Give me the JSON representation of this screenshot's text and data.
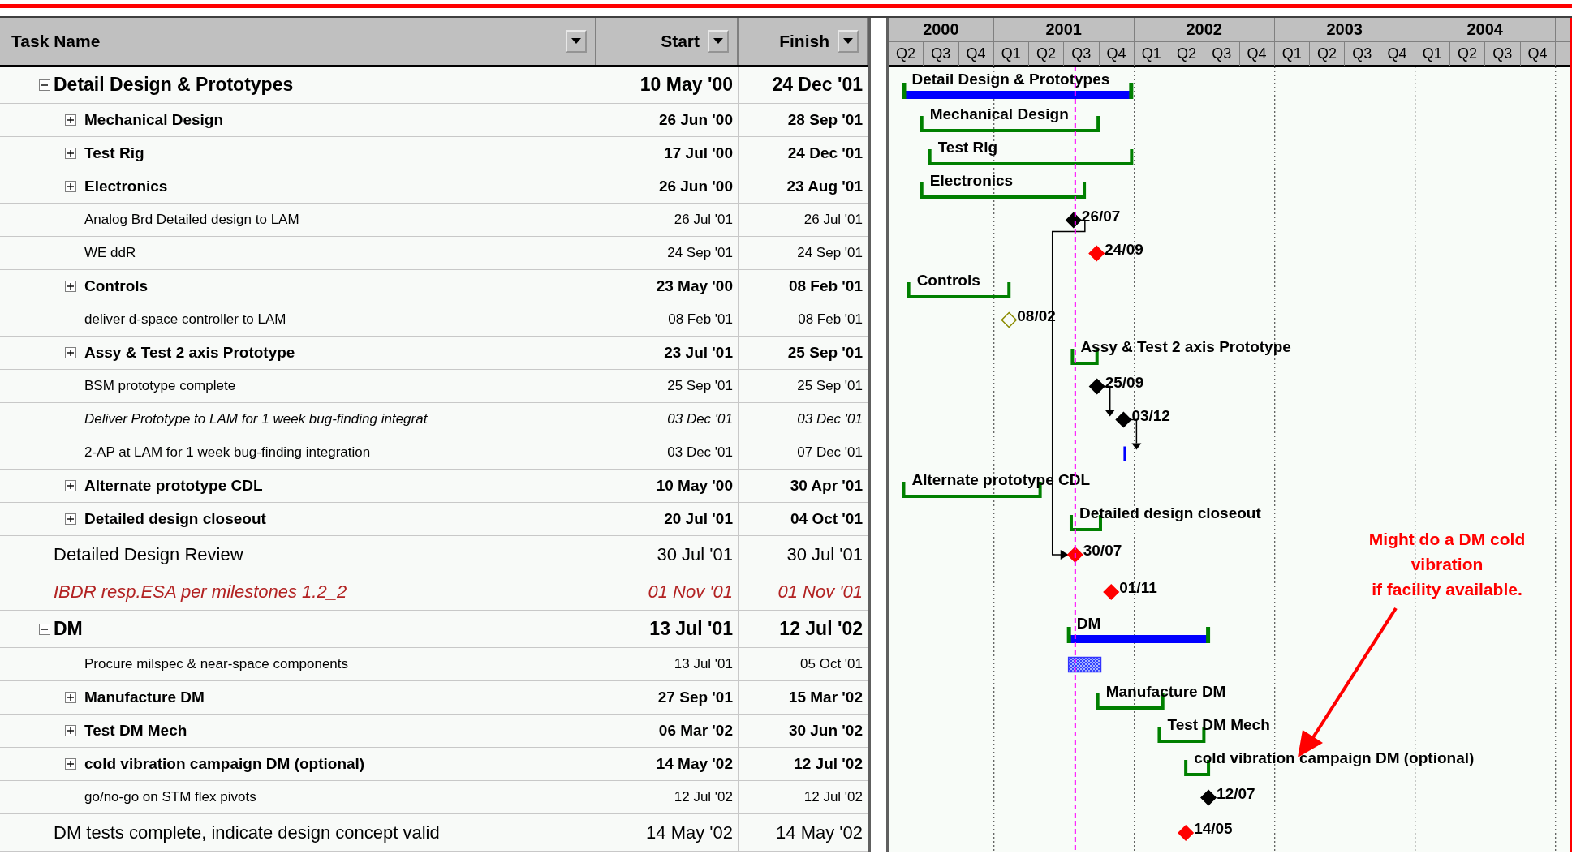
{
  "columns": [
    {
      "label": "Task Name"
    },
    {
      "label": "Start"
    },
    {
      "label": "Finish"
    }
  ],
  "timescale": [
    {
      "year": "2000",
      "quarters": [
        "Q2",
        "Q3",
        "Q4"
      ]
    },
    {
      "year": "2001",
      "quarters": [
        "Q1",
        "Q2",
        "Q3",
        "Q4"
      ]
    },
    {
      "year": "2002",
      "quarters": [
        "Q1",
        "Q2",
        "Q3",
        "Q4"
      ]
    },
    {
      "year": "2003",
      "quarters": [
        "Q1",
        "Q2",
        "Q3",
        "Q4"
      ]
    },
    {
      "year": "2004",
      "quarters": [
        "Q1",
        "Q2",
        "Q3",
        "Q4"
      ]
    }
  ],
  "tasks": [
    {
      "name": "Detail Design & Prototypes",
      "start": "10 May '00",
      "finish": "24 Dec '01",
      "kind": "group",
      "expanded": true,
      "bar": {
        "kind": "group",
        "label": "Detail Design & Prototypes"
      },
      "children": [
        {
          "name": "Mechanical Design",
          "start": "26 Jun '00",
          "finish": "28 Sep '01",
          "kind": "summary",
          "expanded": false,
          "bar": {
            "kind": "summary",
            "label": "Mechanical Design"
          }
        },
        {
          "name": "Test Rig",
          "start": "17 Jul '00",
          "finish": "24 Dec '01",
          "kind": "summary",
          "expanded": false,
          "bar": {
            "kind": "summary",
            "label": "Test Rig"
          }
        },
        {
          "name": "Electronics",
          "start": "26 Jun '00",
          "finish": "23 Aug '01",
          "kind": "summary",
          "expanded": false,
          "bar": {
            "kind": "summary",
            "label": "Electronics"
          }
        },
        {
          "name": "Analog Brd Detailed design to LAM",
          "start": "26 Jul '01",
          "finish": "26 Jul '01",
          "kind": "task",
          "bar": {
            "kind": "milestone",
            "color": "#000000",
            "hollow": false,
            "label": "26/07",
            "link_review": true,
            "today_line": true
          }
        },
        {
          "name": "WE ddR",
          "start": "24 Sep '01",
          "finish": "24 Sep '01",
          "kind": "task",
          "bar": {
            "kind": "milestone",
            "color": "#ff0000",
            "hollow": false,
            "label": "24/09"
          }
        },
        {
          "name": "Controls",
          "start": "23 May '00",
          "finish": "08 Feb '01",
          "kind": "summary",
          "expanded": false,
          "bar": {
            "kind": "summary",
            "label": "Controls"
          }
        },
        {
          "name": "deliver d-space controller to LAM",
          "start": "08 Feb '01",
          "finish": "08 Feb '01",
          "kind": "task",
          "bar": {
            "kind": "milestone",
            "color": "#8b8b00",
            "hollow": true,
            "label": "08/02"
          }
        },
        {
          "name": "Assy & Test 2 axis Prototype",
          "start": "23 Jul '01",
          "finish": "25 Sep '01",
          "kind": "summary",
          "expanded": false,
          "bar": {
            "kind": "summary",
            "label": "Assy & Test 2 axis Prototype"
          }
        },
        {
          "name": "BSM prototype complete",
          "start": "25 Sep '01",
          "finish": "25 Sep '01",
          "kind": "task",
          "bar": {
            "kind": "milestone",
            "color": "#000000",
            "hollow": false,
            "label": "25/09",
            "link_next": true
          }
        },
        {
          "name": "Deliver Prototype to LAM for 1 week bug-finding integrat",
          "start": "03 Dec '01",
          "finish": "03 Dec '01",
          "kind": "task-italic",
          "bar": {
            "kind": "milestone",
            "color": "#000000",
            "hollow": false,
            "label": "03/12",
            "link_next": true
          }
        },
        {
          "name": "2-AP at LAM for 1 week bug-finding integration",
          "start": "03 Dec '01",
          "finish": "07 Dec '01",
          "kind": "task",
          "bar": {
            "kind": "task"
          }
        },
        {
          "name": "Alternate prototype CDL",
          "start": "10 May '00",
          "finish": "30 Apr '01",
          "kind": "summary",
          "expanded": false,
          "bar": {
            "kind": "summary",
            "label": "Alternate prototype CDL"
          }
        },
        {
          "name": "Detailed design closeout",
          "start": "20 Jul '01",
          "finish": "04 Oct '01",
          "kind": "summary",
          "expanded": false,
          "bar": {
            "kind": "summary",
            "label": "Detailed design closeout"
          }
        }
      ]
    },
    {
      "name": "Detailed Design Review",
      "start": "30 Jul '01",
      "finish": "30 Jul '01",
      "kind": "review",
      "bar": {
        "kind": "milestone",
        "color": "#ff0000",
        "hollow": false,
        "label": "30/07"
      }
    },
    {
      "name": "IBDR resp.ESA per milestones 1.2_2",
      "start": "01 Nov '01",
      "finish": "01 Nov '01",
      "kind": "critical",
      "bar": {
        "kind": "milestone",
        "color": "#ff0000",
        "hollow": false,
        "label": "01/11"
      }
    },
    {
      "name": "DM",
      "start": "13 Jul '01",
      "finish": "12 Jul '02",
      "kind": "group",
      "expanded": true,
      "bar": {
        "kind": "group",
        "label": "DM"
      },
      "children": [
        {
          "name": "Procure milspec & near-space components",
          "start": "13 Jul '01",
          "finish": "05 Oct '01",
          "kind": "task",
          "bar": {
            "kind": "hatched"
          }
        },
        {
          "name": "Manufacture DM",
          "start": "27 Sep '01",
          "finish": "15 Mar '02",
          "kind": "summary",
          "expanded": false,
          "bar": {
            "kind": "summary",
            "label": "Manufacture DM"
          }
        },
        {
          "name": "Test DM Mech",
          "start": "06 Mar '02",
          "finish": "30 Jun '02",
          "kind": "summary",
          "expanded": false,
          "bar": {
            "kind": "summary",
            "label": "Test DM Mech"
          }
        },
        {
          "name": "cold vibration campaign DM (optional)",
          "start": "14 May '02",
          "finish": "12 Jul '02",
          "kind": "summary",
          "expanded": false,
          "bar": {
            "kind": "summary",
            "label": "cold vibration campaign DM (optional)"
          }
        },
        {
          "name": "go/no-go on STM flex pivots",
          "start": "12 Jul '02",
          "finish": "12 Jul '02",
          "kind": "task",
          "bar": {
            "kind": "milestone",
            "color": "#000000",
            "hollow": false,
            "label": "12/07"
          }
        }
      ]
    },
    {
      "name": "DM tests complete, indicate design concept valid",
      "start": "14 May '02",
      "finish": "14 May '02",
      "kind": "review",
      "bar": {
        "kind": "milestone",
        "color": "#ff0000",
        "hollow": false,
        "label": "14/05"
      }
    }
  ],
  "annotation": {
    "lines": [
      "Might do a DM cold",
      "vibration",
      "if facility available."
    ]
  }
}
